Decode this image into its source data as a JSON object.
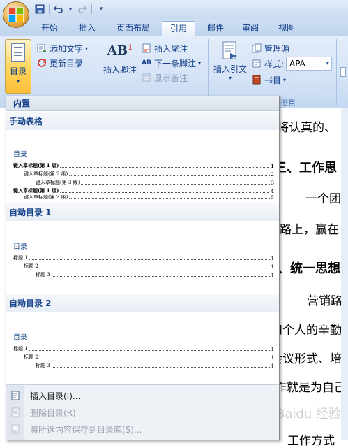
{
  "quick_access": {
    "icons": [
      "save-icon",
      "undo-icon",
      "redo-icon",
      "customize-icon"
    ]
  },
  "tabs": [
    {
      "label": "开始",
      "active": false
    },
    {
      "label": "插入",
      "active": false
    },
    {
      "label": "页面布局",
      "active": false
    },
    {
      "label": "引用",
      "active": true
    },
    {
      "label": "邮件",
      "active": false
    },
    {
      "label": "审阅",
      "active": false
    },
    {
      "label": "视图",
      "active": false
    }
  ],
  "ribbon": {
    "toc_button": "目录",
    "add_text": "添加文字",
    "update_toc": "更新目录",
    "insert_footnote": "插入脚注",
    "insert_endnote": "插入尾注",
    "next_footnote": "下一条脚注",
    "show_notes": "显示备注",
    "insert_citation": "插入引文",
    "manage_sources": "管理源",
    "style_label": "样式:",
    "style_value": "APA",
    "bibliography": "书目",
    "group_label_partial": "书目"
  },
  "gallery": {
    "header": "内置",
    "items": [
      {
        "title": "手动表格",
        "preview_title": "目录",
        "entries": [
          {
            "text": "键入章标题(第 1 级)",
            "page": "1",
            "level": 1
          },
          {
            "text": "键入章标题(第 2 级)",
            "page": "2",
            "level": 2
          },
          {
            "text": "键入章标题(第 3 级)",
            "page": "3",
            "level": 3
          },
          {
            "text": "键入章标题(第 1 级)",
            "page": "4",
            "level": 1
          },
          {
            "text": "键入章标题(第 2 级)",
            "page": "5",
            "level": 2
          }
        ]
      },
      {
        "title": "自动目录 1",
        "preview_title": "目录",
        "entries": [
          {
            "text": "标题 1",
            "page": "1",
            "level": 1
          },
          {
            "text": "标题 2",
            "page": "1",
            "level": 2
          },
          {
            "text": "标题 3",
            "page": "1",
            "level": 3
          }
        ]
      },
      {
        "title": "自动目录 2",
        "preview_title": "目录",
        "entries": [
          {
            "text": "标题 1",
            "page": "1",
            "level": 1
          },
          {
            "text": "标题 2",
            "page": "1",
            "level": 2
          },
          {
            "text": "标题 3",
            "page": "1",
            "level": 3
          }
        ]
      }
    ],
    "menu": [
      {
        "label": "插入目录(I)...",
        "disabled": false
      },
      {
        "label": "删除目录(R)",
        "disabled": true
      },
      {
        "label": "将所选内容保存到目录库(S)...",
        "disabled": true
      }
    ]
  },
  "document": {
    "lines": [
      {
        "text": "都将认真的、",
        "bold": false
      },
      {
        "text": "三、工作思",
        "bold": true
      },
      {
        "text": "一个团",
        "bold": false
      },
      {
        "text": "的路上，赢在",
        "bold": false
      },
      {
        "text": "、统一思想",
        "bold": true
      },
      {
        "text": "营销路",
        "bold": false
      },
      {
        "text": "和个人的辛勤",
        "bold": false
      },
      {
        "text": "会议形式、培",
        "bold": false
      },
      {
        "text": "作就是为自己",
        "bold": false
      },
      {
        "text": "工作方式",
        "bold": false
      }
    ]
  },
  "watermark": "Baidu 经验"
}
